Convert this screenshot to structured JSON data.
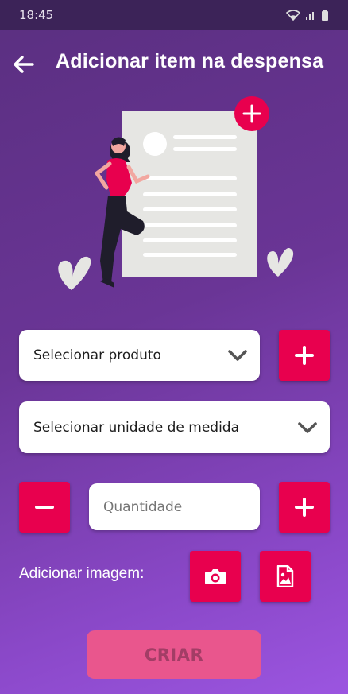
{
  "status_bar": {
    "time": "18:45"
  },
  "app_bar": {
    "title": "Adicionar item na despensa"
  },
  "product_select": {
    "selected_text": "Selecionar produto"
  },
  "unit_select": {
    "selected_text": "Selecionar unidade de medida"
  },
  "quantity": {
    "placeholder": "Quantidade"
  },
  "image_section": {
    "label": "Adicionar imagem:"
  },
  "create_button": {
    "label": "CRIAR",
    "enabled": false
  },
  "colors": {
    "accent": "#e8004e",
    "create_disabled": "#e9568d",
    "bg_top": "#5a2f80",
    "bg_bottom": "#9b55e0"
  },
  "icons": [
    "back-arrow-icon",
    "wifi-icon",
    "signal-icon",
    "battery-icon",
    "chevron-down-icon",
    "plus-icon",
    "minus-icon",
    "camera-icon",
    "image-file-icon"
  ]
}
